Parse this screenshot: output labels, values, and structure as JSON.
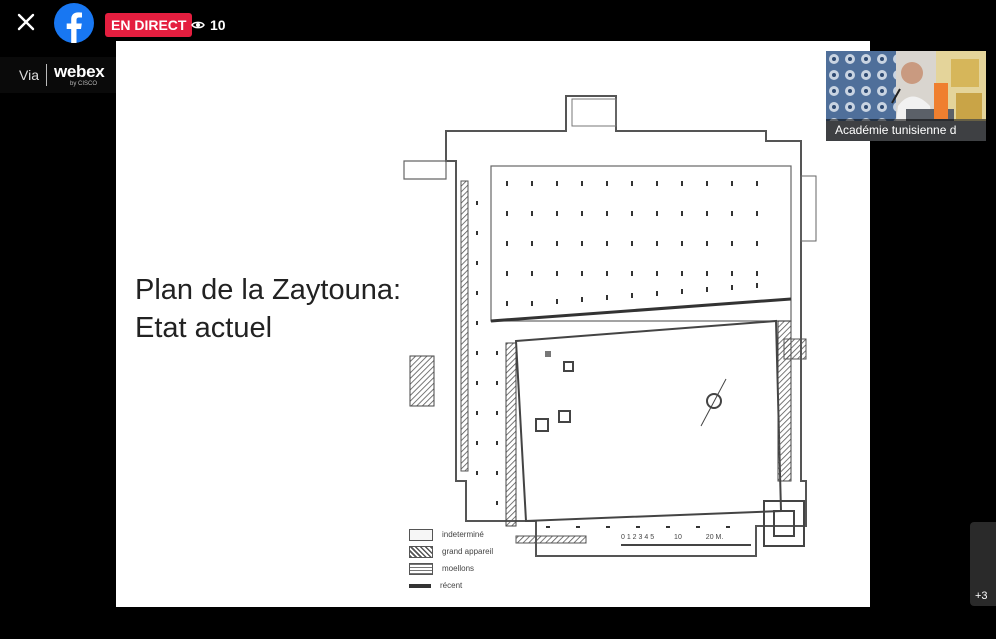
{
  "topbar": {
    "live_label": "EN DIRECT",
    "viewer_count": "10",
    "icons": {
      "close": "close-icon",
      "facebook": "facebook-logo-icon",
      "eye": "eye-icon"
    },
    "live_color": "#e41e3f",
    "facebook_color": "#1877f2"
  },
  "webex": {
    "via_label": "Via",
    "brand_label": "webex",
    "brand_sub": "by CISCO"
  },
  "slide": {
    "title_line1": "Plan  de la Zaytouna:",
    "title_line2": "Etat actuel",
    "legend": [
      {
        "label": "indeterminé"
      },
      {
        "label": "grand appareil"
      },
      {
        "label": "moellons"
      },
      {
        "label": "récent"
      }
    ],
    "scale_label": "0 1 2 3 4 5",
    "scale_end_label": "10",
    "scale_right_label": "20 M."
  },
  "participant": {
    "name": "Académie tunisienne d"
  },
  "more_participants": {
    "label": "+3"
  }
}
